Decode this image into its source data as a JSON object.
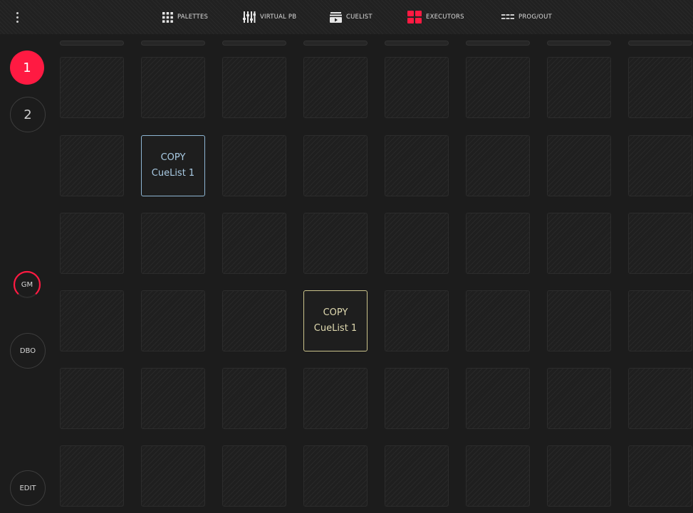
{
  "topbar": {
    "tabs": [
      {
        "label": "PALETTES",
        "icon": "grid-dots-icon"
      },
      {
        "label": "VIRTUAL PB",
        "icon": "sliders-icon"
      },
      {
        "label": "CUELIST",
        "icon": "cuelist-icon"
      },
      {
        "label": "EXECUTORS",
        "icon": "executors-icon",
        "active": true
      },
      {
        "label": "PROG/OUT",
        "icon": "prog-out-icon"
      }
    ]
  },
  "sidebar": {
    "pages": [
      "1",
      "2"
    ],
    "gm_label": "GM",
    "dbo_label": "DBO",
    "edit_label": "EDIT"
  },
  "colors": {
    "accent": "#ff1a42",
    "blue_cell_border": "#8eb6d4",
    "blue_cell_text": "#a9cbe4",
    "yellow_cell_border": "#cbc38b",
    "yellow_cell_text": "#e0dab0"
  },
  "executors": {
    "columns": 8,
    "rows": 6,
    "assigned": [
      {
        "row": 1,
        "col": 1,
        "line1": "COPY",
        "line2": "CueList 1",
        "color": "blue"
      },
      {
        "row": 3,
        "col": 3,
        "line1": "COPY",
        "line2": "CueList 1",
        "color": "yellow"
      }
    ]
  }
}
